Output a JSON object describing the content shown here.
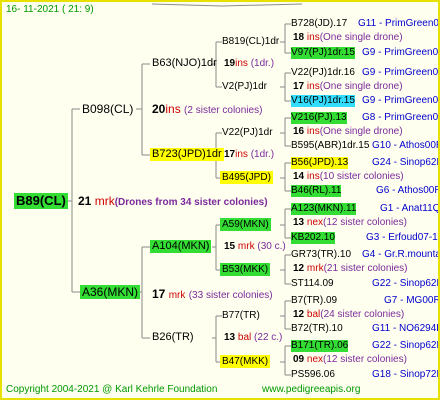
{
  "header": {
    "date": "16- 11-2021 ( 21:  9)"
  },
  "footer": {
    "copyright": "Copyright 2004-2021 @ Karl Kehrle Foundation",
    "site": "www.pedigreeapis.org"
  },
  "root": {
    "name": "B89(CL)",
    "num": "21",
    "ins": "mrk",
    "note": "(Drones from 34 sister colonies)"
  },
  "gen1": [
    {
      "name": "B098(CL)",
      "num": "20",
      "ins": "ins",
      "note": "(2 sister colonies)"
    },
    {
      "name": "A36(MKN)",
      "num": "17",
      "ins": "mrk",
      "note": "(33 sister colonies)"
    }
  ],
  "gen2": [
    {
      "name": "B63(NJO)1dr",
      "num": "19",
      "ins": "ins",
      "note": "(1dr.)"
    },
    {
      "name": "B723(JPD)1dr",
      "num": "17",
      "ins": "ins",
      "note": "(1dr.)"
    },
    {
      "name": "A104(MKN)",
      "num": "15",
      "ins": "mrk",
      "note": "(30 c.)"
    },
    {
      "name": "B26(TR)",
      "num": "13",
      "ins": "bal",
      "note": "(22 c.)"
    }
  ],
  "gen3": [
    {
      "name": "B819(CL)1dr"
    },
    {
      "name": "V2(PJ)1dr"
    },
    {
      "name": "V22(PJ)1dr"
    },
    {
      "name": "B495(JPD)"
    },
    {
      "name": "A59(MKN)"
    },
    {
      "name": "B53(MKK)"
    },
    {
      "name": "B77(TR)"
    },
    {
      "name": "B47(MKK)"
    }
  ],
  "gen4": [
    {
      "name": "B728(JD).17",
      "info": "G11 - PrimGreen00"
    },
    {
      "num": "18",
      "ins": "ins",
      "note": "(One single drone)"
    },
    {
      "name": "V97(PJ)1dr.15",
      "info": "G9 - PrimGreen00"
    },
    {
      "name": "V22(PJ)1dr.16",
      "info": "G9 - PrimGreen00"
    },
    {
      "num": "17",
      "ins": "ins",
      "note": "(One single drone)"
    },
    {
      "name": "V16(PJ)1dr.15",
      "info": "G9 - PrimGreen00"
    },
    {
      "name": "V216(PJ).13",
      "info": "G8 - PrimGreen00"
    },
    {
      "num": "16",
      "ins": "ins",
      "note": "(One single drone)"
    },
    {
      "name": "B595(ABR)1dr.15",
      "info": "G10 - Athos00R"
    },
    {
      "name": "B56(JPD).13",
      "info": "G24 - Sinop62R"
    },
    {
      "num": "14",
      "ins": "ins",
      "note": "(10 sister colonies)"
    },
    {
      "name": "B46(RL).11",
      "info": "G6 - Athos00R"
    },
    {
      "name": "A123(MKN).11",
      "info": "G1 - Anat11Q"
    },
    {
      "num": "13",
      "ins": "nex",
      "note": "(12 sister colonies)"
    },
    {
      "name": "KB202.10",
      "info": "G3 - Erfoud07-1Q"
    },
    {
      "name": "GR73(TR).10",
      "info": "G4 - Gr.R.mounta"
    },
    {
      "num": "12",
      "ins": "mrk",
      "note": "(21 sister colonies)"
    },
    {
      "name": "ST114.09",
      "info": "G22 - Sinop62R"
    },
    {
      "name": "B7(TR).09",
      "info": "G7 - MG00R"
    },
    {
      "num": "12",
      "ins": "bal",
      "note": "(24 sister colonies)"
    },
    {
      "name": "B72(TR).10",
      "info": "G11 - NO6294R"
    },
    {
      "name": "B171(TR).06",
      "info": "G22 - Sinop62R"
    },
    {
      "num": "09",
      "ins": "nex",
      "note": "(12 sister colonies)"
    },
    {
      "name": "PS596.06",
      "info": "G18 - Sinop72R"
    }
  ],
  "colors": {
    "border": "#e8e000",
    "green": "#33dd33",
    "yellow": "#ffff00",
    "cyan": "#33ddff",
    "line": "#8a8a8a"
  }
}
